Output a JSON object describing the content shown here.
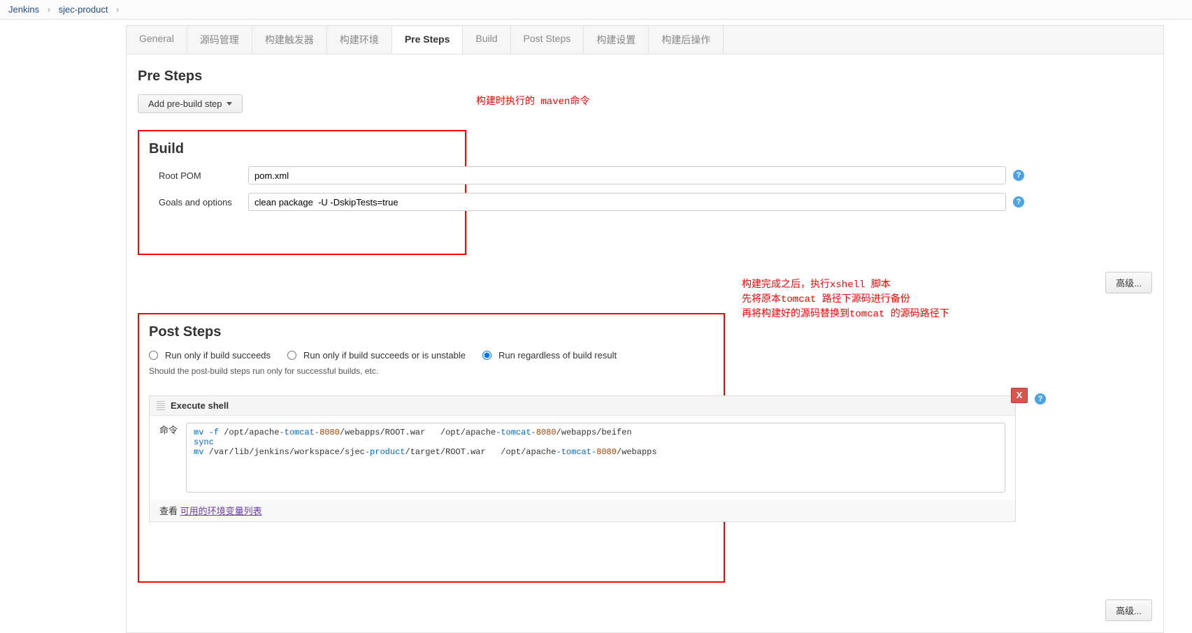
{
  "breadcrumb": {
    "root": "Jenkins",
    "project": "sjec-product"
  },
  "tabs": [
    {
      "label": "General",
      "active": false
    },
    {
      "label": "源码管理",
      "active": false
    },
    {
      "label": "构建触发器",
      "active": false
    },
    {
      "label": "构建环境",
      "active": false
    },
    {
      "label": "Pre Steps",
      "active": true
    },
    {
      "label": "Build",
      "active": false
    },
    {
      "label": "Post Steps",
      "active": false
    },
    {
      "label": "构建设置",
      "active": false
    },
    {
      "label": "构建后操作",
      "active": false
    }
  ],
  "pre_steps": {
    "title": "Pre Steps",
    "add_button": "Add pre-build step"
  },
  "annotations": {
    "maven_note": "构建时执行的 maven命令",
    "post_note_line1": "构建完成之后，执行xshell 脚本",
    "post_note_line2": "先将原本tomcat 路径下源码进行备份",
    "post_note_line3": "再将构建好的源码替换到tomcat 的源码路径下"
  },
  "build": {
    "title": "Build",
    "root_pom_label": "Root POM",
    "root_pom_value": "pom.xml",
    "goals_label": "Goals and options",
    "goals_value": "clean package  -U -DskipTests=true",
    "advanced": "高级..."
  },
  "post_steps": {
    "title": "Post Steps",
    "radio1": "Run only if build succeeds",
    "radio2": "Run only if build succeeds or is unstable",
    "radio3": "Run regardless of build result",
    "hint": "Should the post-build steps run only for successful builds, etc.",
    "shell": {
      "header": "Execute shell",
      "cmd_label": "命令",
      "delete": "X",
      "script": "mv -f /opt/apache-tomcat-8080/webapps/ROOT.war   /opt/apache-tomcat-8080/webapps/beifen\nsync\nmv /var/lib/jenkins/workspace/sjec-product/target/ROOT.war   /opt/apache-tomcat-8080/webapps",
      "link_prefix": "查看 ",
      "link_text": "可用的环境变量列表"
    },
    "advanced": "高级..."
  }
}
